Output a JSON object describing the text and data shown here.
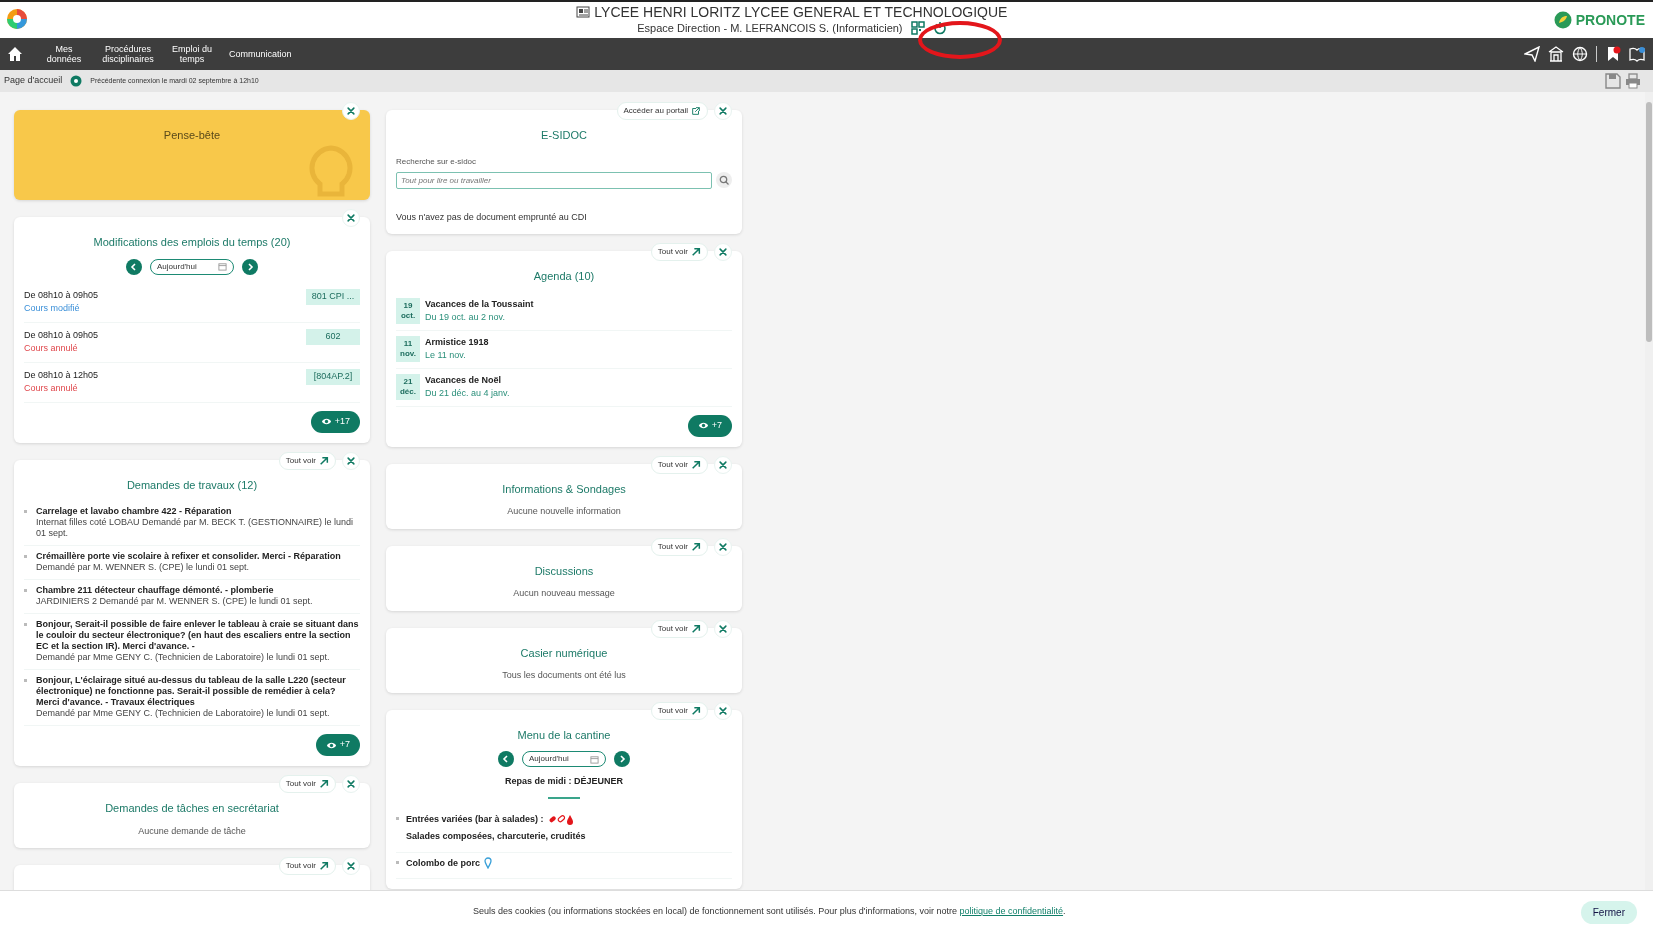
{
  "header": {
    "title": "LYCEE HENRI LORITZ LYCEE GENERAL ET TECHNOLOGIQUE",
    "subtitle": "Espace Direction - M. LEFRANCOIS S. (Informaticien)",
    "brand": "PRONOTE"
  },
  "nav": {
    "items": [
      {
        "label": "Mes données"
      },
      {
        "label": "Procédures disciplinaires"
      },
      {
        "label": "Emploi du temps"
      },
      {
        "label": "Communication"
      }
    ]
  },
  "breadcrumb": {
    "page": "Page d'accueil",
    "last_login": "Précédente connexion le mardi 02 septembre à 12h10"
  },
  "left_column": [
    {
      "kind": "note",
      "title": "Pense-bête",
      "closable": true
    },
    {
      "kind": "timetable",
      "title": "Modifications des emplois du temps (20)",
      "closable": true,
      "date": "Aujourd'hui",
      "entries": [
        {
          "time": "De 08h10 à 09h05",
          "status": "Cours modifié",
          "kind": "modified",
          "room": "801 CPI ..."
        },
        {
          "time": "De 08h10 à 09h05",
          "status": "Cours annulé",
          "kind": "cancelled",
          "room": "602"
        },
        {
          "time": "De 08h10 à 12h05",
          "status": "Cours annulé",
          "kind": "cancelled",
          "room": "[804AP.2]"
        }
      ],
      "more": "+17"
    },
    {
      "kind": "requests",
      "title": "Demandes de travaux (12)",
      "action": "Tout voir",
      "closable": true,
      "items": [
        {
          "title": "Carrelage et lavabo chambre 422 - Réparation",
          "detail": "Internat filles coté LOBAU Demandé par M. BECK T. (GESTIONNAIRE) le lundi 01 sept."
        },
        {
          "title": "Crémaillère porte vie scolaire à refixer et consolider. Merci - Réparation",
          "detail": "Demandé par M. WENNER S. (CPE) le lundi 01 sept."
        },
        {
          "title": "Chambre 211 détecteur chauffage démonté. - plomberie",
          "detail": "JARDINIERS 2 Demandé par M. WENNER S. (CPE) le lundi 01 sept."
        },
        {
          "title": "Bonjour, Serait-il possible de faire enlever le tableau à craie se situant dans le couloir du secteur électronique? (en haut des escaliers entre la section EC et la section IR). Merci d'avance. -",
          "detail": "Demandé par Mme GENY C. (Technicien de Laboratoire) le lundi 01 sept."
        },
        {
          "title": "Bonjour, L'éclairage situé au-dessus du tableau de la salle L220 (secteur électronique) ne fonctionne pas. Serait-il possible de remédier à cela? Merci d'avance. - Travaux électriques",
          "detail": "Demandé par Mme GENY C. (Technicien de Laboratoire) le lundi 01 sept."
        }
      ],
      "more": "+7"
    },
    {
      "kind": "empty",
      "title": "Demandes de tâches en secrétariat",
      "action": "Tout voir",
      "closable": true,
      "message": "Aucune demande de tâche"
    },
    {
      "kind": "stub",
      "action": "Tout voir",
      "closable": true
    }
  ],
  "middle_column": [
    {
      "kind": "search",
      "title": "E-SIDOC",
      "action": "Accéder au portail",
      "closable": true,
      "label": "Recherche sur e-sidoc",
      "placeholder": "Tout pour lire ou travailler",
      "message": "Vous n'avez pas de document emprunté au CDI"
    },
    {
      "kind": "agenda",
      "title": "Agenda (10)",
      "action": "Tout voir",
      "closable": true,
      "items": [
        {
          "day": "19",
          "month": "oct.",
          "title": "Vacances de la Toussaint",
          "dates": "Du 19 oct. au 2 nov."
        },
        {
          "day": "11",
          "month": "nov.",
          "title": "Armistice 1918",
          "dates": "Le 11 nov."
        },
        {
          "day": "21",
          "month": "déc.",
          "title": "Vacances de Noël",
          "dates": "Du 21 déc. au 4 janv."
        }
      ],
      "more": "+7"
    },
    {
      "kind": "empty",
      "title": "Informations & Sondages",
      "action": "Tout voir",
      "closable": true,
      "message": "Aucune nouvelle information"
    },
    {
      "kind": "empty",
      "title": "Discussions",
      "action": "Tout voir",
      "closable": true,
      "message": "Aucun nouveau message"
    },
    {
      "kind": "empty",
      "title": "Casier numérique",
      "action": "Tout voir",
      "closable": true,
      "message": "Tous les documents ont été lus"
    },
    {
      "kind": "menu",
      "title": "Menu de la cantine",
      "action": "Tout voir",
      "closable": true,
      "date": "Aujourd'hui",
      "meal": "Repas de midi : DÉJEUNER",
      "dishes": [
        {
          "name": "Entrées variées (bar à salades) :",
          "kind": "allergens",
          "description": "Salades composées, charcuterie, crudités"
        },
        {
          "name": "Colombo de porc",
          "kind": "marker"
        }
      ]
    }
  ],
  "cookie_bar": {
    "text": "Seuls des cookies (ou informations stockées en local) de fonctionnement sont utilisés. Pour plus d'informations, voir notre",
    "link": "politique de confidentialité",
    "trail": ".",
    "button": "Fermer"
  }
}
